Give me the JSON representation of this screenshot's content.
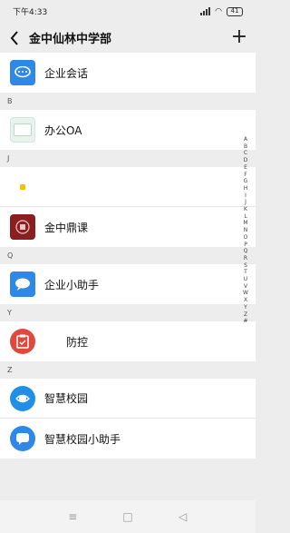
{
  "status": {
    "time": "下午4:33",
    "battery": "41"
  },
  "header": {
    "title": "金中仙林中学部"
  },
  "items": {
    "enterprise_chat": "企业会话",
    "office_oa": "办公OA",
    "j_unknown": "",
    "jinzhong_course": "金中鼎课",
    "assistant": "企业小助手",
    "epidemic": "防控",
    "smart_campus": "智慧校园",
    "smart_assistant": "智慧校园小助手"
  },
  "sections": {
    "b": "B",
    "j": "J",
    "q": "Q",
    "y": "Y",
    "z": "Z"
  },
  "alphabet": [
    "A",
    "B",
    "C",
    "D",
    "E",
    "F",
    "G",
    "H",
    "I",
    "J",
    "K",
    "L",
    "M",
    "N",
    "O",
    "P",
    "Q",
    "R",
    "S",
    "T",
    "U",
    "V",
    "W",
    "X",
    "Y",
    "Z",
    "#"
  ],
  "nav": {
    "menu": "≡",
    "home": "□",
    "back": "◁"
  },
  "colors": {
    "blue": "#2f87e8",
    "red": "#e0483d",
    "darkred": "#8b1e1e"
  }
}
